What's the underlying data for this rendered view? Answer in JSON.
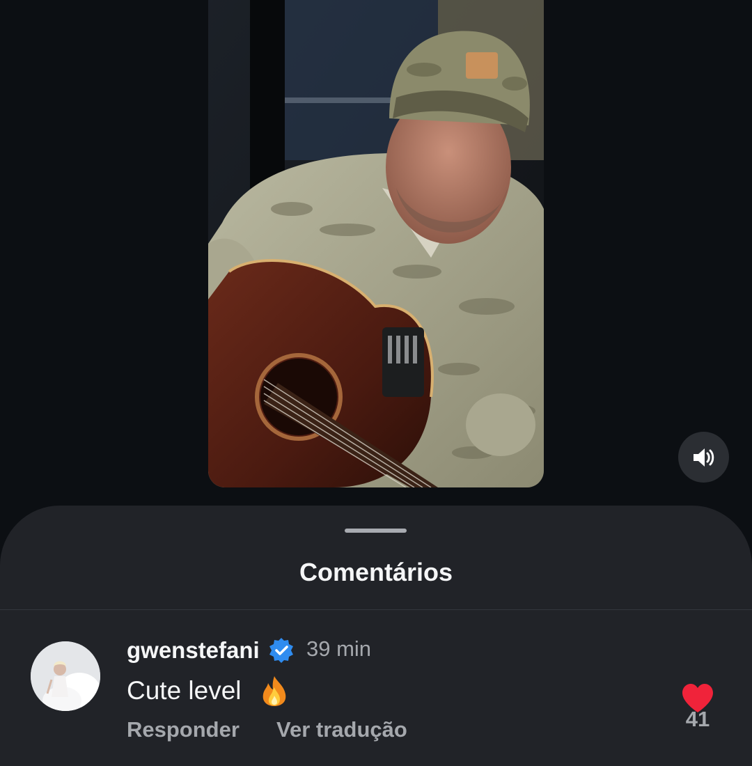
{
  "video": {
    "mute_icon": "speaker-volume-icon"
  },
  "comments_sheet": {
    "title": "Comentários",
    "comment": {
      "username": "gwenstefani",
      "verified": true,
      "time": "39 min",
      "text": "Cute level",
      "emoji_icon": "fire-icon",
      "reply_label": "Responder",
      "translate_label": "Ver tradução",
      "like_count": "41",
      "like_color": "#f0233a"
    }
  },
  "colors": {
    "background": "#0c0f13",
    "sheet": "#212328",
    "verified_badge": "#2f8cf0"
  }
}
